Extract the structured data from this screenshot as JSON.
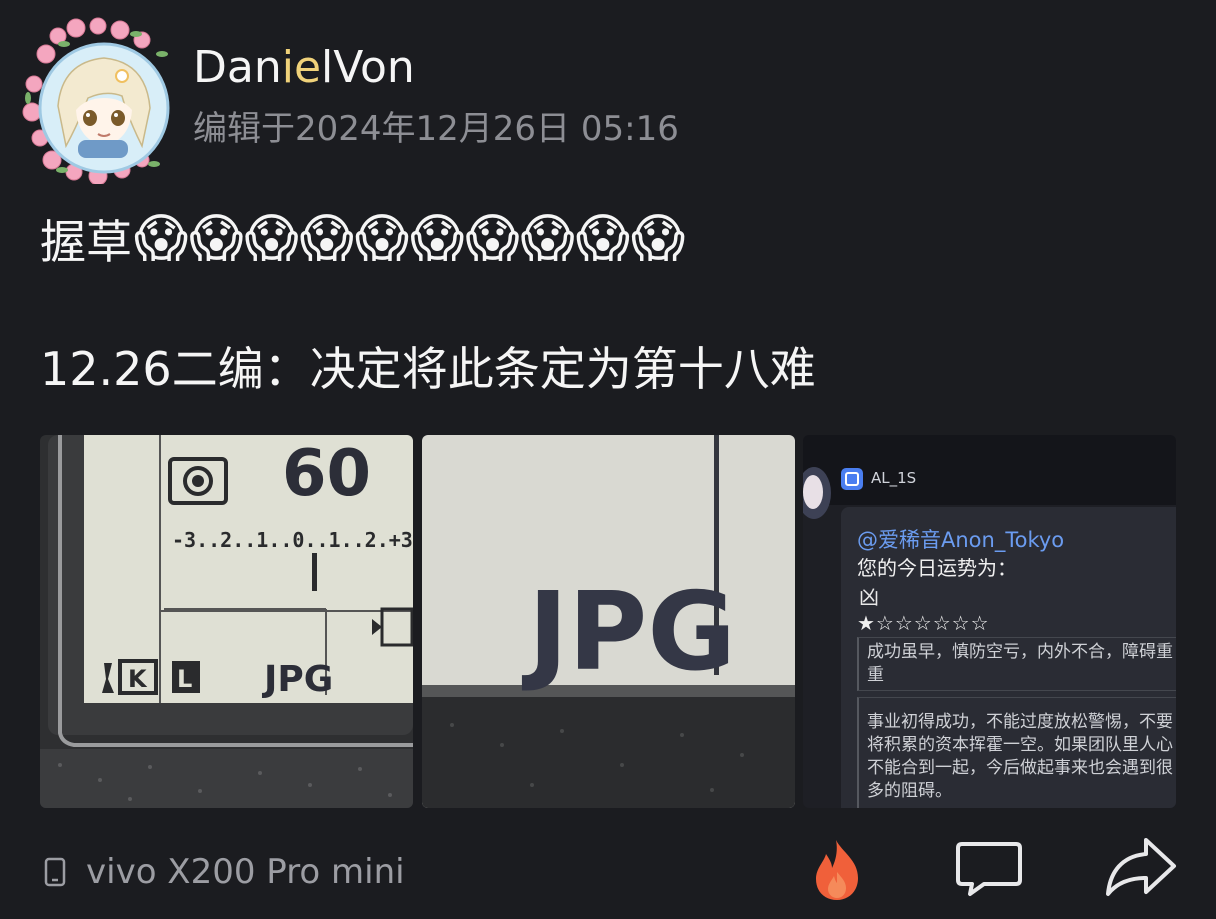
{
  "post": {
    "author": {
      "name_before": "Dan",
      "name_highlight": "ie",
      "name_after": "lVon"
    },
    "edit_time": "编辑于2024年12月26日 05:16",
    "line1_text": "握草",
    "line1_emoji": [
      "😱",
      "😱",
      "😱",
      "😱",
      "😱",
      "😱",
      "😱",
      "😱",
      "😱",
      "😱"
    ],
    "line2_text": "12.26二编：决定将此条定为第十八难",
    "images": {
      "img1": {
        "shutter": "60",
        "exposure_scale": "-3..2..1..0..1..2.+3",
        "k_label": "K",
        "size_label": "L",
        "format_label": "JPG"
      },
      "img2": {
        "format_label": "JPG"
      },
      "img3": {
        "bot_name": "AL_1S",
        "mention": "@爱稀音Anon_Tokyo",
        "fortune_title": "您的今日运势为：",
        "fortune_glyph": "凶",
        "stars": "★☆☆☆☆☆☆",
        "poem": "成功虽早，慎防空亏，内外不合，障碍重重",
        "detail": "事业初得成功，不能过度放松警惕，不要将积累的资本挥霍一空。如果团队里人心不能合到一起，今后做起事来也会遇到很多的阻碍。"
      }
    },
    "device": "vivo X200 Pro mini",
    "actions": {
      "like_icon": "fire-icon",
      "comment_icon": "comment-icon",
      "share_icon": "share-icon"
    },
    "colors": {
      "background": "#1b1c20",
      "text_primary": "#f5f5f5",
      "text_secondary": "#8d8e94",
      "name_highlight": "#f0d27a",
      "fire": "#f0603a"
    }
  }
}
